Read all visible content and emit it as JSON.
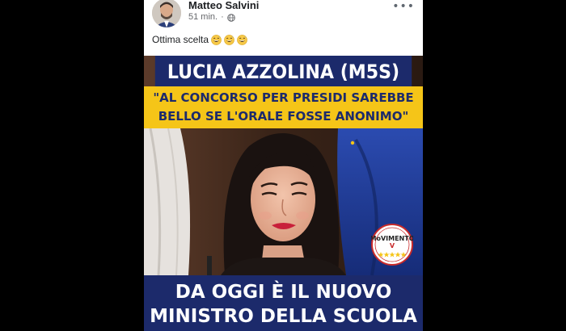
{
  "post": {
    "author": "Matteo Salvini",
    "time": "51 min.",
    "separator": "·",
    "more": "•••",
    "text": "Ottima scelta",
    "emojis": [
      "grinning-sweat-emoji",
      "grinning-sweat-emoji",
      "grinning-sweat-emoji"
    ]
  },
  "meme": {
    "top_banner": "LUCIA AZZOLINA (M5S)",
    "quote_line1": "\"AL CONCORSO PER PRESIDI SAREBBE",
    "quote_line2": "BELLO SE L'ORALE FOSSE ANONIMO\"",
    "bottom_line1": "DA OGGI È IL NUOVO",
    "bottom_line2": "MINISTRO DELLA SCUOLA",
    "logo_text": "MoVIMENTO"
  },
  "colors": {
    "background": "#000000",
    "card": "#ffffff",
    "banner_blue": "#1c2a6b",
    "banner_yellow": "#f5c518",
    "eu_flag_blue": "#1f3d9a"
  }
}
